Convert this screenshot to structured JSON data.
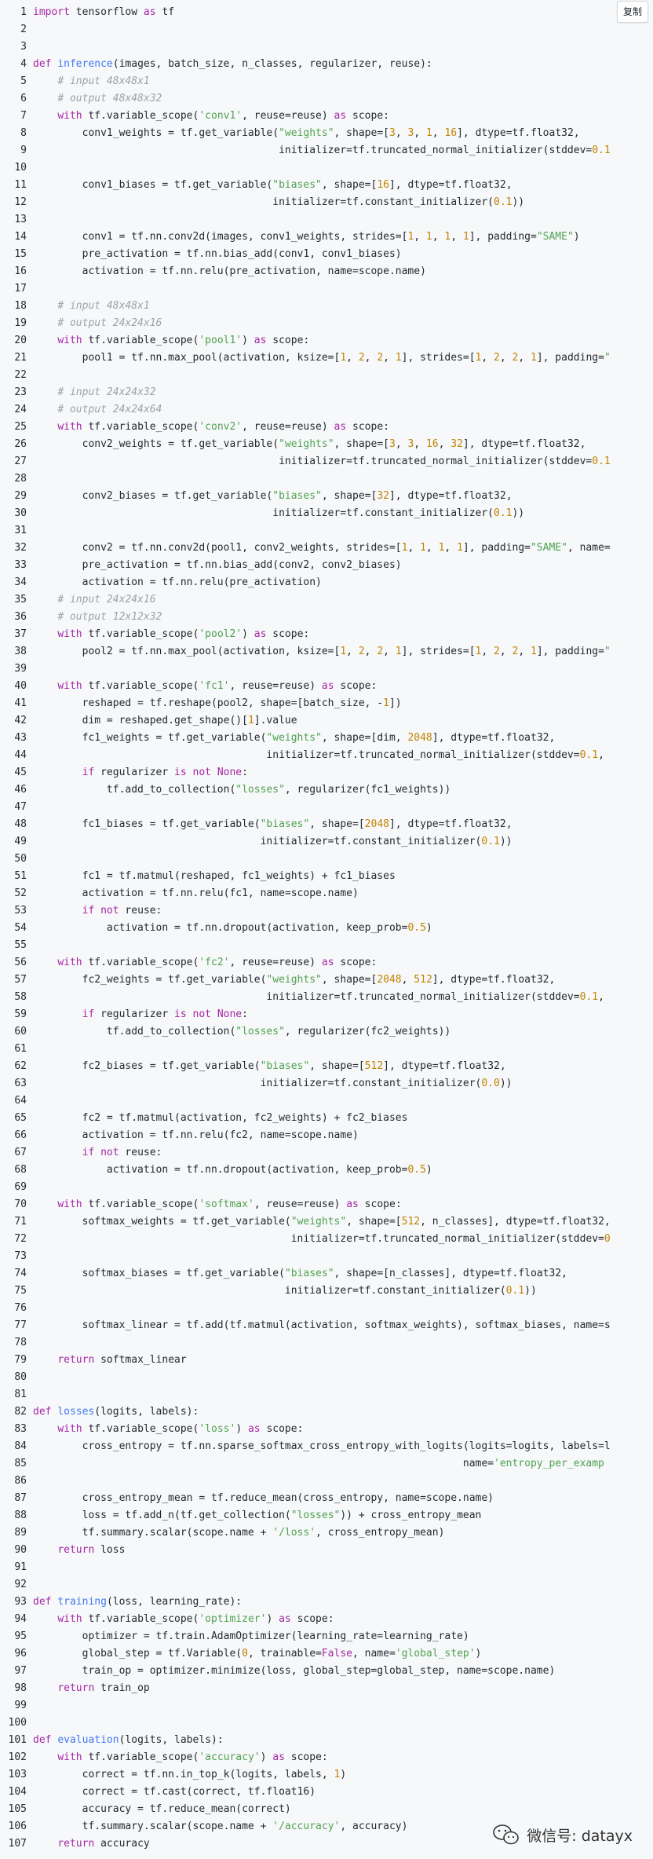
{
  "toolbar": {
    "copy_label": "复制"
  },
  "watermark": {
    "text": "微信号: datayx",
    "icon": "wechat-icon"
  },
  "colors": {
    "keyword": "#a626a4",
    "function": "#4078f2",
    "string": "#50a14f",
    "number": "#c18401",
    "comment": "#a0a1a7",
    "background": "#f6f8fa"
  },
  "code": {
    "lines": [
      "import tensorflow as tf",
      "",
      "",
      "def inference(images, batch_size, n_classes, regularizer, reuse):",
      "    # input 48x48x1",
      "    # output 48x48x32",
      "    with tf.variable_scope('conv1', reuse=reuse) as scope:",
      "        conv1_weights = tf.get_variable(\"weights\", shape=[3, 3, 1, 16], dtype=tf.float32,",
      "                                        initializer=tf.truncated_normal_initializer(stddev=0.1",
      "",
      "        conv1_biases = tf.get_variable(\"biases\", shape=[16], dtype=tf.float32,",
      "                                       initializer=tf.constant_initializer(0.1))",
      "",
      "        conv1 = tf.nn.conv2d(images, conv1_weights, strides=[1, 1, 1, 1], padding=\"SAME\")",
      "        pre_activation = tf.nn.bias_add(conv1, conv1_biases)",
      "        activation = tf.nn.relu(pre_activation, name=scope.name)",
      "",
      "    # input 48x48x1",
      "    # output 24x24x16",
      "    with tf.variable_scope('pool1') as scope:",
      "        pool1 = tf.nn.max_pool(activation, ksize=[1, 2, 2, 1], strides=[1, 2, 2, 1], padding=\"",
      "",
      "    # input 24x24x32",
      "    # output 24x24x64",
      "    with tf.variable_scope('conv2', reuse=reuse) as scope:",
      "        conv2_weights = tf.get_variable(\"weights\", shape=[3, 3, 16, 32], dtype=tf.float32,",
      "                                        initializer=tf.truncated_normal_initializer(stddev=0.1",
      "",
      "        conv2_biases = tf.get_variable(\"biases\", shape=[32], dtype=tf.float32,",
      "                                       initializer=tf.constant_initializer(0.1))",
      "",
      "        conv2 = tf.nn.conv2d(pool1, conv2_weights, strides=[1, 1, 1, 1], padding=\"SAME\", name=",
      "        pre_activation = tf.nn.bias_add(conv2, conv2_biases)",
      "        activation = tf.nn.relu(pre_activation)",
      "    # input 24x24x16",
      "    # output 12x12x32",
      "    with tf.variable_scope('pool2') as scope:",
      "        pool2 = tf.nn.max_pool(activation, ksize=[1, 2, 2, 1], strides=[1, 2, 2, 1], padding=\"",
      "",
      "    with tf.variable_scope('fc1', reuse=reuse) as scope:",
      "        reshaped = tf.reshape(pool2, shape=[batch_size, -1])",
      "        dim = reshaped.get_shape()[1].value",
      "        fc1_weights = tf.get_variable(\"weights\", shape=[dim, 2048], dtype=tf.float32,",
      "                                      initializer=tf.truncated_normal_initializer(stddev=0.1,",
      "        if regularizer is not None:",
      "            tf.add_to_collection(\"losses\", regularizer(fc1_weights))",
      "",
      "        fc1_biases = tf.get_variable(\"biases\", shape=[2048], dtype=tf.float32,",
      "                                     initializer=tf.constant_initializer(0.1))",
      "",
      "        fc1 = tf.matmul(reshaped, fc1_weights) + fc1_biases",
      "        activation = tf.nn.relu(fc1, name=scope.name)",
      "        if not reuse:",
      "            activation = tf.nn.dropout(activation, keep_prob=0.5)",
      "",
      "    with tf.variable_scope('fc2', reuse=reuse) as scope:",
      "        fc2_weights = tf.get_variable(\"weights\", shape=[2048, 512], dtype=tf.float32,",
      "                                      initializer=tf.truncated_normal_initializer(stddev=0.1,",
      "        if regularizer is not None:",
      "            tf.add_to_collection(\"losses\", regularizer(fc2_weights))",
      "",
      "        fc2_biases = tf.get_variable(\"biases\", shape=[512], dtype=tf.float32,",
      "                                     initializer=tf.constant_initializer(0.0))",
      "",
      "        fc2 = tf.matmul(activation, fc2_weights) + fc2_biases",
      "        activation = tf.nn.relu(fc2, name=scope.name)",
      "        if not reuse:",
      "            activation = tf.nn.dropout(activation, keep_prob=0.5)",
      "",
      "    with tf.variable_scope('softmax', reuse=reuse) as scope:",
      "        softmax_weights = tf.get_variable(\"weights\", shape=[512, n_classes], dtype=tf.float32,",
      "                                          initializer=tf.truncated_normal_initializer(stddev=0",
      "",
      "        softmax_biases = tf.get_variable(\"biases\", shape=[n_classes], dtype=tf.float32,",
      "                                         initializer=tf.constant_initializer(0.1))",
      "",
      "        softmax_linear = tf.add(tf.matmul(activation, softmax_weights), softmax_biases, name=s",
      "",
      "    return softmax_linear",
      "",
      "",
      "def losses(logits, labels):",
      "    with tf.variable_scope('loss') as scope:",
      "        cross_entropy = tf.nn.sparse_softmax_cross_entropy_with_logits(logits=logits, labels=l",
      "                                                                      name='entropy_per_examp",
      "",
      "        cross_entropy_mean = tf.reduce_mean(cross_entropy, name=scope.name)",
      "        loss = tf.add_n(tf.get_collection(\"losses\")) + cross_entropy_mean",
      "        tf.summary.scalar(scope.name + '/loss', cross_entropy_mean)",
      "    return loss",
      "",
      "",
      "def training(loss, learning_rate):",
      "    with tf.variable_scope('optimizer') as scope:",
      "        optimizer = tf.train.AdamOptimizer(learning_rate=learning_rate)",
      "        global_step = tf.Variable(0, trainable=False, name='global_step')",
      "        train_op = optimizer.minimize(loss, global_step=global_step, name=scope.name)",
      "    return train_op",
      "",
      "",
      "def evaluation(logits, labels):",
      "    with tf.variable_scope('accuracy') as scope:",
      "        correct = tf.nn.in_top_k(logits, labels, 1)",
      "        correct = tf.cast(correct, tf.float16)",
      "        accuracy = tf.reduce_mean(correct)",
      "        tf.summary.scalar(scope.name + '/accuracy', accuracy)",
      "    return accuracy"
    ]
  }
}
